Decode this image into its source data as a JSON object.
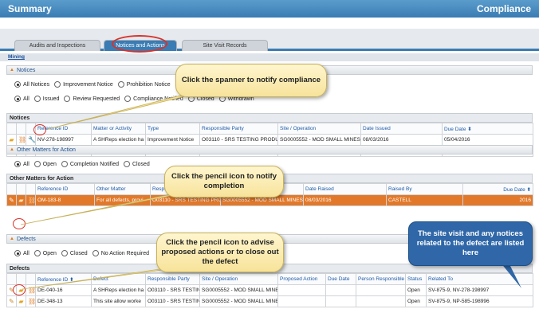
{
  "header": {
    "title": "Summary",
    "right": "Compliance"
  },
  "tabs": [
    {
      "label": "Audits and Inspections"
    },
    {
      "label": "Notices and Actions"
    },
    {
      "label": "Site Visit Records"
    }
  ],
  "subnav": {
    "label": "Mining"
  },
  "notices": {
    "section_title": "Notices",
    "filter1": [
      "All Notices",
      "Improvement Notice",
      "Prohibition Notice"
    ],
    "filter2": [
      "All",
      "Issued",
      "Review Requested",
      "Compliance Notified",
      "Closed",
      "Withdrawn"
    ],
    "grid_title": "Notices",
    "columns": [
      "Reference ID",
      "Matter or Activity",
      "Type",
      "Responsible Party",
      "Site / Operation",
      "Date Issued",
      "Due Date"
    ],
    "rows": [
      [
        "NV-278-198997",
        "A SHReps election ha",
        "Improvement Notice",
        "O03110 - SRS TESTING PRODUC",
        "SG0005552 - MOD SMALL MINES",
        "08/03/2016",
        "05/04/2016"
      ],
      [
        "NV-975-198984",
        "Light Vehicle inciden",
        "Prohibition Notice",
        "O03110 - SRS TESTING PRODUC",
        "SG0005552 - MOD SMALL MINES",
        "08/03/2016",
        ""
      ]
    ]
  },
  "other": {
    "section_title": "Other Matters for Action",
    "filter": [
      "All",
      "Open",
      "Completion Notified",
      "Closed"
    ],
    "grid_title": "Other Matters for Action",
    "columns": [
      "Reference ID",
      "Other Matter",
      "Responsible Party",
      "Site / Operation",
      "Date Raised",
      "Raised By",
      "Due Date"
    ],
    "rows": [
      [
        "OM-183-8",
        "For all defects, provi",
        "O03110 - SRS TESTING PRODUC",
        "SG0005552 - MOD SMALL MINES",
        "08/03/2016",
        "CASTELL",
        "2016"
      ]
    ]
  },
  "defects": {
    "section_title": "Defects",
    "filter": [
      "All",
      "Open",
      "Closed",
      "No Action Required"
    ],
    "grid_title": "Defects",
    "columns": [
      "Reference ID",
      "Defect",
      "Responsible Party",
      "Site / Operation",
      "Proposed Action",
      "Due Date",
      "Person Responsible",
      "Status",
      "Related To"
    ],
    "rows": [
      [
        "DE-040-16",
        "A SHReps election ha",
        "O03110 - SRS TESTING PRODUC",
        "SG0005552 - MOD SMALL MINES",
        "",
        "",
        "",
        "Open",
        "SV-875-9, NV-278-198997"
      ],
      [
        "DE-348-13",
        "This site allow worke",
        "O03110 - SRS TESTING PRODUC",
        "SG0005552 - MOD SMALL MINES",
        "",
        "",
        "",
        "Open",
        "SV-875-9, NP-585-198996"
      ]
    ]
  },
  "callouts": {
    "c1": "Click the spanner to notify compliance",
    "c2": "Click the pencil icon to notify completion",
    "c3": "Click the pencil icon to advise proposed actions or to close out the defect",
    "c4": "The site visit and any notices related to the defect are listed here"
  },
  "icons": {
    "folder": "folder-icon",
    "link": "link-icon",
    "wrench": "wrench-icon",
    "pencil": "pencil-icon",
    "sort": "sort-icon"
  },
  "colors": {
    "accent": "#3a7cb3",
    "highlight_row": "#e2792a",
    "annotation_ring": "#d8322b",
    "callout_bg": "#fff6cf"
  }
}
